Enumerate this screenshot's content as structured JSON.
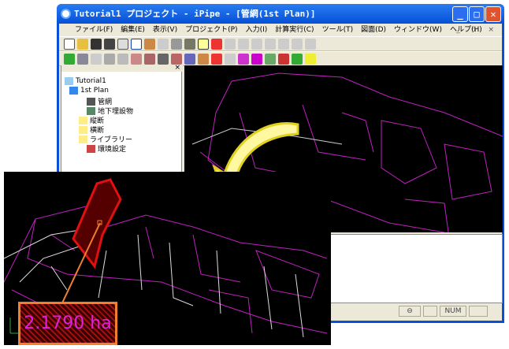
{
  "window": {
    "title": "Tutorial1 プロジェクト - iPipe - [管網(1st Plan)]"
  },
  "menu": [
    "ファイル(F)",
    "編集(E)",
    "表示(V)",
    "プロジェクト(P)",
    "入力(I)",
    "計算実行(C)",
    "ツール(T)",
    "図面(D)",
    "ウィンドウ(W)",
    "ヘルプ(H)"
  ],
  "tree": {
    "root": "Tutorial1",
    "plan": "1st Plan",
    "items": [
      "管網",
      "地下埋設物",
      "縦断",
      "横断",
      "ライブラリー",
      "環境設定"
    ]
  },
  "status": {
    "num": "NUM"
  },
  "inset": {
    "area": "2.1790 ha"
  },
  "colors": {
    "outline": "#c020c0",
    "highlight": "#e01010",
    "arrow": "#f0f020",
    "label_border": "#f08030"
  }
}
